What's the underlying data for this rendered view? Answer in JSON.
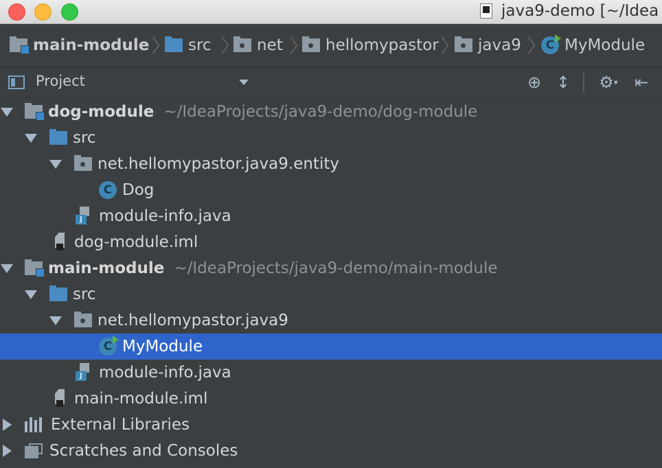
{
  "window": {
    "title": "java9-demo [~/Idea"
  },
  "breadcrumb": [
    {
      "label": "main-module",
      "icon": "module-folder-icon"
    },
    {
      "label": "src",
      "icon": "source-folder-icon"
    },
    {
      "label": "net",
      "icon": "package-icon"
    },
    {
      "label": "hellomypastor",
      "icon": "package-icon"
    },
    {
      "label": "java9",
      "icon": "package-icon"
    },
    {
      "label": "MyModule",
      "icon": "runnable-class-icon"
    }
  ],
  "toolwindow": {
    "title": "Project",
    "tools": [
      "locate-icon",
      "collapse-all-icon",
      "gear-icon",
      "hide-icon"
    ]
  },
  "tree": [
    {
      "label": "dog-module",
      "path": "~/IdeaProjects/java9-demo/dog-module",
      "type": "module",
      "expanded": true
    },
    {
      "label": "src",
      "type": "source-folder",
      "expanded": true
    },
    {
      "label": "net.hellomypastor.java9.entity",
      "type": "package",
      "expanded": true
    },
    {
      "label": "Dog",
      "type": "class",
      "class_letter": "C"
    },
    {
      "label": "module-info.java",
      "type": "java-file"
    },
    {
      "label": "dog-module.iml",
      "type": "iml-file"
    },
    {
      "label": "main-module",
      "path": "~/IdeaProjects/java9-demo/main-module",
      "type": "module",
      "expanded": true
    },
    {
      "label": "src",
      "type": "source-folder",
      "expanded": true
    },
    {
      "label": "net.hellomypastor.java9",
      "type": "package",
      "expanded": true
    },
    {
      "label": "MyModule",
      "type": "runnable-class",
      "class_letter": "C",
      "selected": true
    },
    {
      "label": "module-info.java",
      "type": "java-file"
    },
    {
      "label": "main-module.iml",
      "type": "iml-file"
    },
    {
      "label": "External Libraries",
      "type": "libraries",
      "expanded": false
    },
    {
      "label": "Scratches and Consoles",
      "type": "scratches",
      "expanded": false
    }
  ],
  "colors": {
    "background": "#3c3f41",
    "selection": "#2f65ca",
    "text": "#d4d6d8",
    "path_text": "#8d9195",
    "folder_blue": "#4a8bc2",
    "class_icon": "#3d87b5"
  }
}
